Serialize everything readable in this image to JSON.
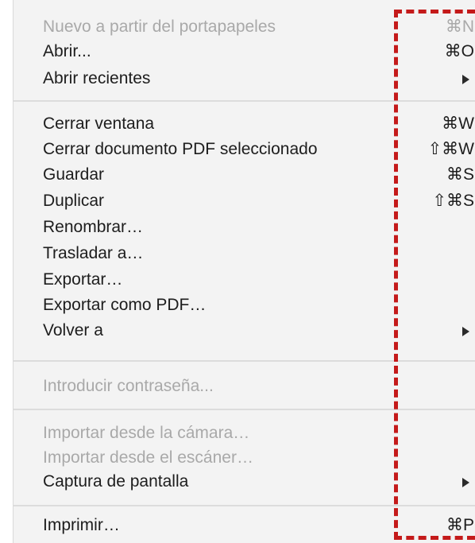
{
  "menu": {
    "items": [
      {
        "label": "Nuevo a partir del portapapeles",
        "shortcut": "⌘N",
        "disabled": true,
        "submenu": false
      },
      {
        "label": "Abrir...",
        "shortcut": "⌘O",
        "disabled": false,
        "submenu": false
      },
      {
        "label": "Abrir recientes",
        "shortcut": "",
        "disabled": false,
        "submenu": true
      },
      {
        "label": "Cerrar ventana",
        "shortcut": "⌘W",
        "disabled": false,
        "submenu": false
      },
      {
        "label": "Cerrar documento PDF seleccionado",
        "shortcut": "⇧⌘W",
        "disabled": false,
        "submenu": false
      },
      {
        "label": "Guardar",
        "shortcut": "⌘S",
        "disabled": false,
        "submenu": false
      },
      {
        "label": "Duplicar",
        "shortcut": "⇧⌘S",
        "disabled": false,
        "submenu": false
      },
      {
        "label": "Renombrar…",
        "shortcut": "",
        "disabled": false,
        "submenu": false
      },
      {
        "label": "Trasladar a…",
        "shortcut": "",
        "disabled": false,
        "submenu": false
      },
      {
        "label": "Exportar…",
        "shortcut": "",
        "disabled": false,
        "submenu": false
      },
      {
        "label": "Exportar como PDF…",
        "shortcut": "",
        "disabled": false,
        "submenu": false
      },
      {
        "label": "Volver a",
        "shortcut": "",
        "disabled": false,
        "submenu": true
      },
      {
        "label": "Introducir contraseña...",
        "shortcut": "",
        "disabled": true,
        "submenu": false
      },
      {
        "label": "Importar desde la cámara…",
        "shortcut": "",
        "disabled": true,
        "submenu": false
      },
      {
        "label": "Importar desde el escáner…",
        "shortcut": "",
        "disabled": true,
        "submenu": false
      },
      {
        "label": "Captura de pantalla",
        "shortcut": "",
        "disabled": false,
        "submenu": true
      },
      {
        "label": "Imprimir…",
        "shortcut": "⌘P",
        "disabled": false,
        "submenu": false
      }
    ]
  },
  "colors": {
    "menu_background": "#f3f3f3",
    "enabled_text": "#1d1d1d",
    "disabled_text": "#a9a9a9",
    "separator": "#dcdcdc",
    "highlight_dash": "#c41a1a"
  }
}
